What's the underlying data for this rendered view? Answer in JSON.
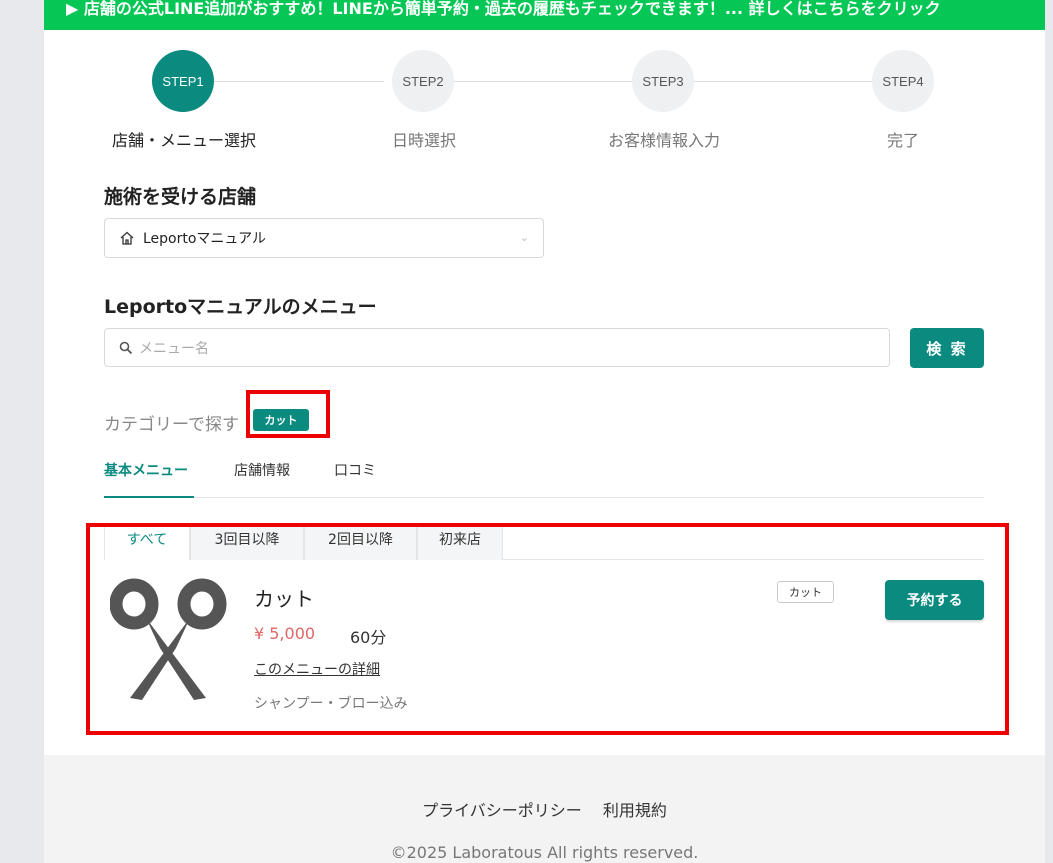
{
  "banner": {
    "text": "▶ 店舗の公式LINE追加がおすすめ！LINEから簡単予約・過去の履歴もチェックできます！... 詳しくはこちらをクリック"
  },
  "steps": [
    {
      "circle": "STEP1",
      "label": "店舗・メニュー選択",
      "active": true
    },
    {
      "circle": "STEP2",
      "label": "日時選択",
      "active": false
    },
    {
      "circle": "STEP3",
      "label": "お客様情報入力",
      "active": false
    },
    {
      "circle": "STEP4",
      "label": "完了",
      "active": false
    }
  ],
  "store": {
    "heading": "施術を受ける店舗",
    "selected": "Leportoマニュアル"
  },
  "menu_section": {
    "heading": "Leportoマニュアルのメニュー",
    "search_placeholder": "メニュー名",
    "search_button": "検 索",
    "category_label": "カテゴリーで探す",
    "category_chip": "カット"
  },
  "tabs": [
    "基本メニュー",
    "店舗情報",
    "口コミ"
  ],
  "subtabs": [
    "すべて",
    "3回目以降",
    "2回目以降",
    "初来店"
  ],
  "menu_item": {
    "name": "カット",
    "price": "¥ 5,000",
    "duration": "60分",
    "detail_link": "このメニューの詳細",
    "description": "シャンプー・ブロー込み",
    "tag": "カット",
    "reserve_button": "予約する"
  },
  "footer": {
    "privacy": "プライバシーポリシー",
    "terms": "利用規約",
    "copyright": "©2025 Laboratous All rights reserved."
  },
  "colors": {
    "accent": "#0b8a80",
    "banner": "#06c755",
    "price": "#e06666",
    "highlight": "#e00000"
  }
}
